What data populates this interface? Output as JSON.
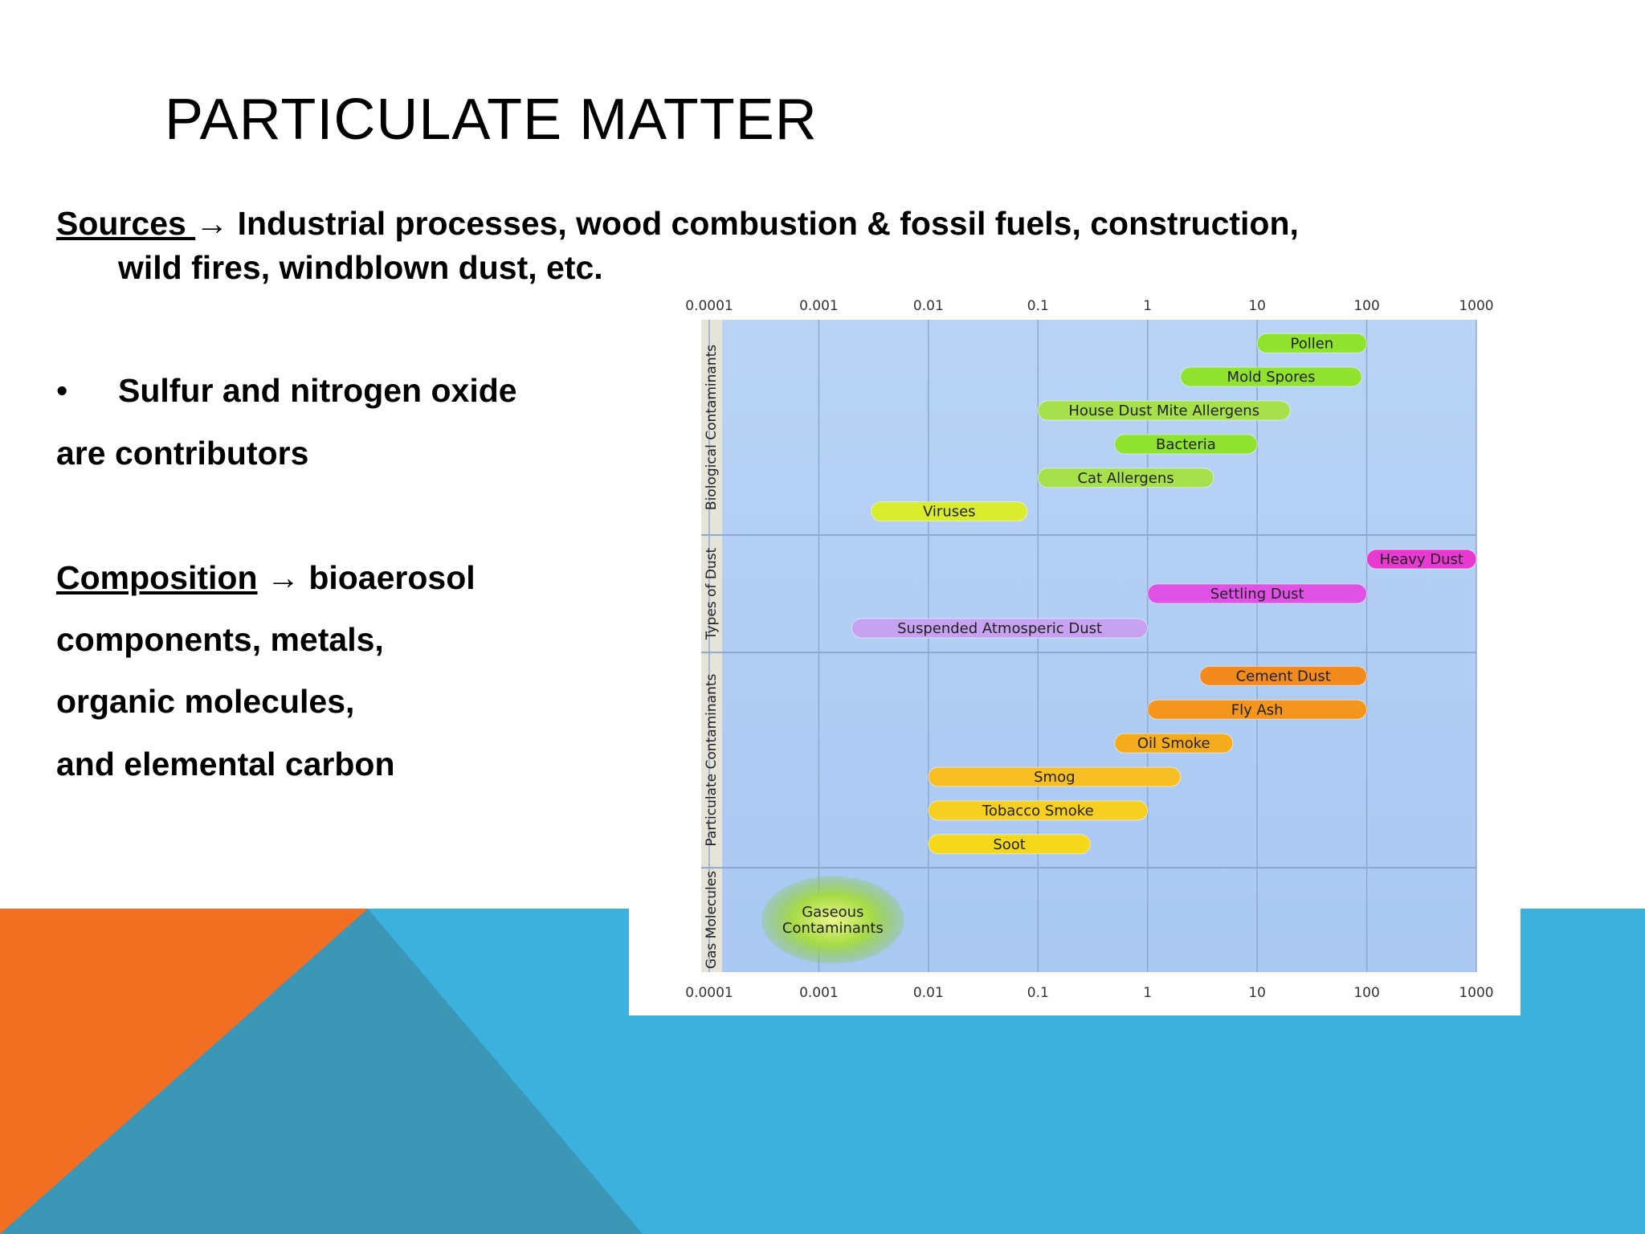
{
  "slide": {
    "title": "PARTICULATE MATTER",
    "sources_label": "Sources ",
    "arrow": "→",
    "sources_text_1": " Industrial processes, wood combustion & fossil fuels, construction,",
    "sources_text_2": "wild fires, windblown dust, etc.",
    "bullet": "•",
    "bullet_text_1": "Sulfur and nitrogen oxide",
    "bullet_text_2": "are contributors",
    "composition_label": "Composition",
    "composition_text_1": " bioaerosol",
    "composition_text_2": "components, metals,",
    "composition_text_3": "organic molecules,",
    "composition_text_4": "and elemental carbon",
    "colors": {
      "orange": "#f26f21",
      "teal": "#3c96b5",
      "blue": "#3cb1de"
    }
  },
  "chart_data": {
    "type": "bar",
    "orientation": "horizontal",
    "x_scale": "log",
    "xlim": [
      0.0001,
      1000
    ],
    "xticks": [
      "0.0001",
      "0.001",
      "0.01",
      "0.1",
      "1",
      "10",
      "100",
      "1000"
    ],
    "groups": [
      {
        "name": "Biological Contaminants",
        "items": [
          {
            "label": "Pollen",
            "range": [
              10,
              100
            ],
            "color": "#8fe22d"
          },
          {
            "label": "Mold Spores",
            "range": [
              2,
              90
            ],
            "color": "#8fe22d"
          },
          {
            "label": "House Dust Mite Allergens",
            "range": [
              0.1,
              20
            ],
            "color": "#a6e04a"
          },
          {
            "label": "Bacteria",
            "range": [
              0.5,
              10
            ],
            "color": "#8fe22d"
          },
          {
            "label": "Cat Allergens",
            "range": [
              0.1,
              4
            ],
            "color": "#a6e04a"
          },
          {
            "label": "Viruses",
            "range": [
              0.003,
              0.08
            ],
            "color": "#d9ec2e"
          }
        ]
      },
      {
        "name": "Types of Dust",
        "items": [
          {
            "label": "Heavy Dust",
            "range": [
              100,
              1000
            ],
            "color": "#e83ad0"
          },
          {
            "label": "Settling Dust",
            "range": [
              1,
              100
            ],
            "color": "#e052e6"
          },
          {
            "label": "Suspended Atmosperic Dust",
            "range": [
              0.002,
              1
            ],
            "color": "#c6a2f0"
          }
        ]
      },
      {
        "name": "Particulate Contaminants",
        "items": [
          {
            "label": "Cement Dust",
            "range": [
              3,
              100
            ],
            "color": "#f28a1e"
          },
          {
            "label": "Fly Ash",
            "range": [
              1,
              100
            ],
            "color": "#f4961e"
          },
          {
            "label": "Oil Smoke",
            "range": [
              0.5,
              6
            ],
            "color": "#f5ac1c"
          },
          {
            "label": "Smog",
            "range": [
              0.01,
              2
            ],
            "color": "#f7bf24"
          },
          {
            "label": "Tobacco Smoke",
            "range": [
              0.01,
              1
            ],
            "color": "#f7cf20"
          },
          {
            "label": "Soot",
            "range": [
              0.01,
              0.3
            ],
            "color": "#f5d81a"
          }
        ]
      },
      {
        "name": "Gas Molecules",
        "items": [
          {
            "label": "Gaseous\nContaminants",
            "range": [
              0.0003,
              0.006
            ],
            "shape": "ellipse",
            "color": "#8cd23a"
          }
        ]
      }
    ]
  }
}
